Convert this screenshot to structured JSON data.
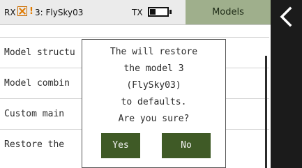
{
  "status": {
    "rx_label": "RX",
    "warning_glyph": "!",
    "model_label": "3: FlySky03",
    "tx_label": "TX",
    "battery_level_percent": 35,
    "rx_error_color": "#e07a00"
  },
  "header": {
    "tab_title": "Models",
    "tab_color": "#9faf8c",
    "back_icon": "chevron-left-icon"
  },
  "list": {
    "items": [
      {
        "label": "Model structu"
      },
      {
        "label": "Model combin"
      },
      {
        "label": "Custom main"
      },
      {
        "label": "Restore the"
      }
    ]
  },
  "dialog": {
    "lines": [
      "The will restore",
      "the model 3",
      "(FlySky03)",
      "to defaults.",
      "Are you sure?"
    ],
    "yes_label": "Yes",
    "no_label": "No",
    "button_color": "#3f5a26"
  }
}
